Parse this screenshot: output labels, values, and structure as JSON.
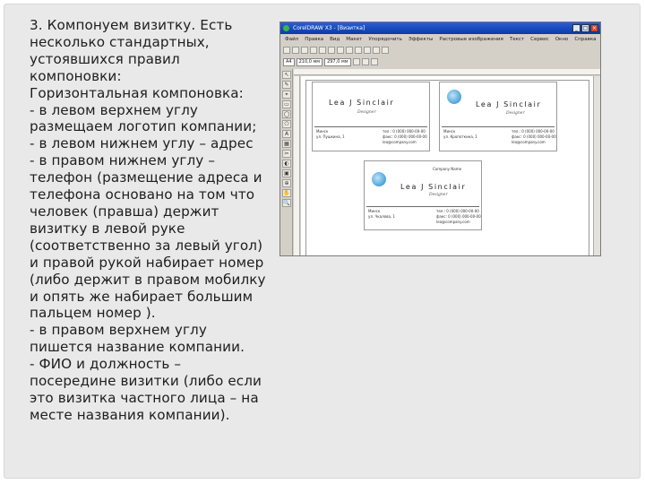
{
  "slide": {
    "text": "3. Компонуем визитку. Есть\nнесколько стандартных,\nустоявшихся правил\nкомпоновки:\nГоризонтальная компоновка:\n- в левом верхнем углу\nразмещаем логотип компании;\n- в левом нижнем углу – адрес\n- в правом нижнем углу –\nтелефон (размещение адреса и\nтелефона основано на том что\nчеловек (правша) держит\nвизитку в левой руке\n(соответственно за левый угол)\nи правой рукой набирает номер\n(либо держит в правом мобилку\nи опять же набирает большим\nпальцем номер   ).\n- в правом верхнем углу\nпишется название компании.\n- ФИО и должность –\nпосередине визитки (либо если\nэто визитка частного лица – на\nместе названия компании)."
  },
  "screenshot": {
    "window_title": "CorelDRAW X3 - [Визитка]",
    "window_buttons": [
      "_",
      "□",
      "×"
    ],
    "menu": [
      "Файл",
      "Правка",
      "Вид",
      "Макет",
      "Упорядочить",
      "Эффекты",
      "Растровые изображения",
      "Текст",
      "Сервис",
      "Окно",
      "Справка"
    ],
    "toolbar_fields": [
      "A4",
      "210,0 мм",
      "297,0 мм"
    ],
    "tools": [
      "↖",
      "✎",
      "⌖",
      "▭",
      "◯",
      "⬠",
      "A",
      "▦",
      "✂",
      "◐",
      "▣",
      "⊕",
      "✋",
      "🔍"
    ],
    "cards": [
      {
        "company": "",
        "name": "Lea J Sinclair",
        "role": "Designer",
        "address": "Минск\nул. Пушкина, 1",
        "phones": "тел.: 0 (000) 000-00-00\nфакс: 0 (000) 000-00-00\nlea@company.com",
        "has_logo": false
      },
      {
        "company": "",
        "name": "Lea J Sinclair",
        "role": "Designer",
        "address": "Минск\nул. Кропоткина, 1",
        "phones": "тел.: 0 (000) 000-00-00\nфакс: 0 (000) 000-00-00\nlea@company.com",
        "has_logo": true
      },
      {
        "company": "Company Name",
        "name": "Lea J Sinclair",
        "role": "Designer",
        "address": "Минск\nул. Чкалова, 1",
        "phones": "тел.: 0 (000) 000-00-00\nфакс: 0 (000) 000-00-00\nlea@company.com",
        "has_logo": true
      }
    ]
  }
}
